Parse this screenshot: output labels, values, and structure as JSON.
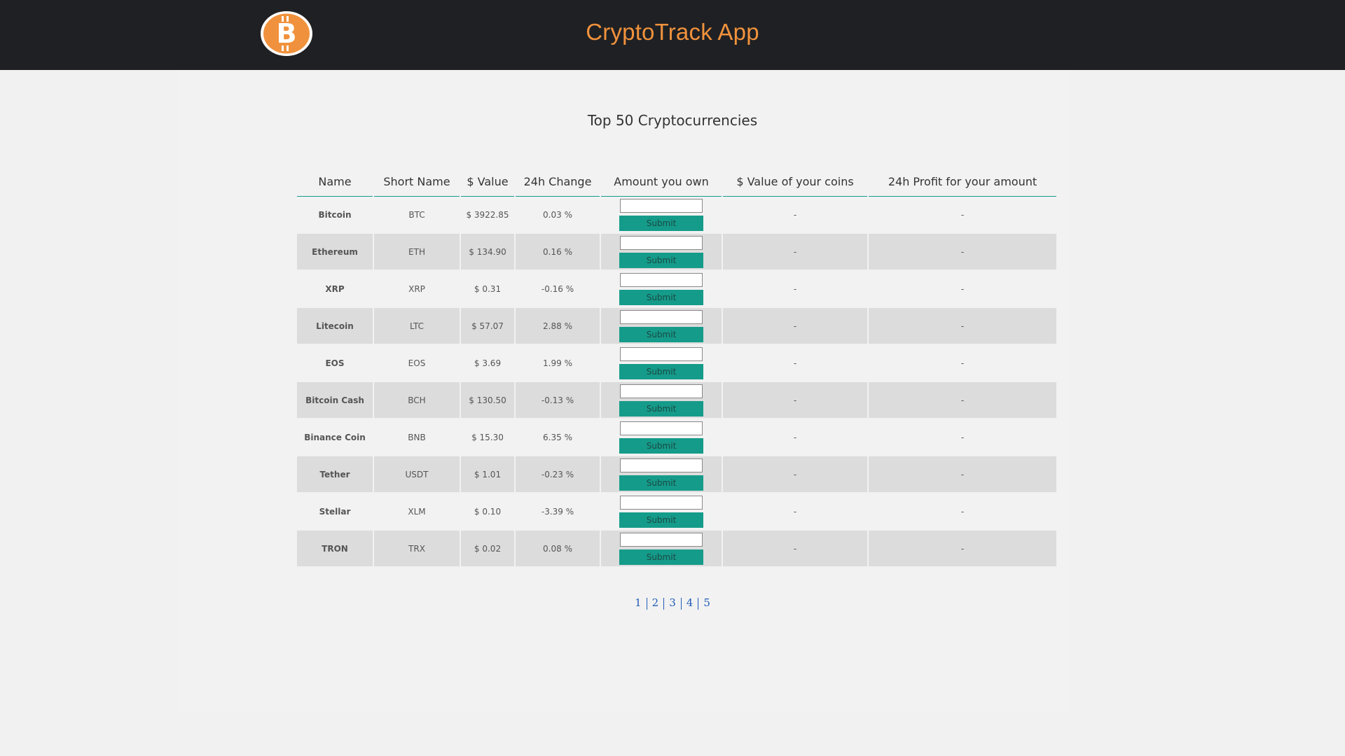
{
  "app": {
    "title": "CryptoTrack App",
    "logo_icon": "bitcoin-logo-icon"
  },
  "colors": {
    "header_bg": "#1f2023",
    "accent": "#f0923d",
    "teal": "#159b8a",
    "positive": "#2f48c8",
    "negative": "#e0243a"
  },
  "page": {
    "heading": "Top 50 Cryptocurrencies"
  },
  "table": {
    "headers": [
      "Name",
      "Short Name",
      "$ Value",
      "24h Change",
      "Amount you own",
      "$ Value of your coins",
      "24h Profit for your amount"
    ],
    "submit_label": "Submit",
    "rows": [
      {
        "name": "Bitcoin",
        "short": "BTC",
        "value": "$ 3922.85",
        "change": "0.03 %",
        "coins_value": "-",
        "profit": "-"
      },
      {
        "name": "Ethereum",
        "short": "ETH",
        "value": "$ 134.90",
        "change": "0.16 %",
        "coins_value": "-",
        "profit": "-"
      },
      {
        "name": "XRP",
        "short": "XRP",
        "value": "$ 0.31",
        "change": "-0.16 %",
        "coins_value": "-",
        "profit": "-"
      },
      {
        "name": "Litecoin",
        "short": "LTC",
        "value": "$ 57.07",
        "change": "2.88 %",
        "coins_value": "-",
        "profit": "-"
      },
      {
        "name": "EOS",
        "short": "EOS",
        "value": "$ 3.69",
        "change": "1.99 %",
        "coins_value": "-",
        "profit": "-"
      },
      {
        "name": "Bitcoin Cash",
        "short": "BCH",
        "value": "$ 130.50",
        "change": "-0.13 %",
        "coins_value": "-",
        "profit": "-"
      },
      {
        "name": "Binance Coin",
        "short": "BNB",
        "value": "$ 15.30",
        "change": "6.35 %",
        "coins_value": "-",
        "profit": "-"
      },
      {
        "name": "Tether",
        "short": "USDT",
        "value": "$ 1.01",
        "change": "-0.23 %",
        "coins_value": "-",
        "profit": "-"
      },
      {
        "name": "Stellar",
        "short": "XLM",
        "value": "$ 0.10",
        "change": "-3.39 %",
        "coins_value": "-",
        "profit": "-"
      },
      {
        "name": "TRON",
        "short": "TRX",
        "value": "$ 0.02",
        "change": "0.08 %",
        "coins_value": "-",
        "profit": "-"
      }
    ]
  },
  "pagination": {
    "pages": [
      "1",
      "2",
      "3",
      "4",
      "5"
    ]
  }
}
